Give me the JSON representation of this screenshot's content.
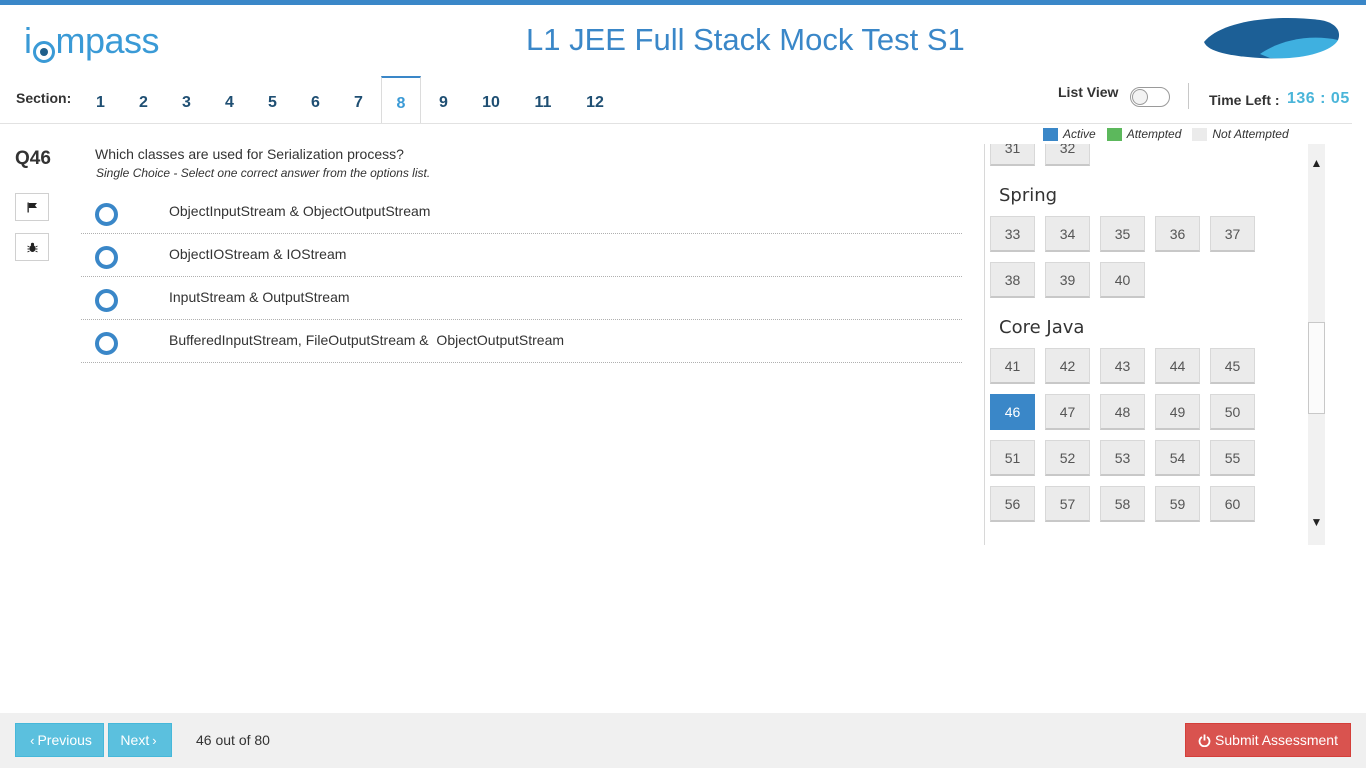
{
  "header": {
    "logo_text": "icompass",
    "title": "L1 JEE Full Stack Mock Test S1"
  },
  "sections": {
    "label": "Section:",
    "tabs": [
      "1",
      "2",
      "3",
      "4",
      "5",
      "6",
      "7",
      "8",
      "9",
      "10",
      "11",
      "12"
    ],
    "active": "8"
  },
  "controls": {
    "list_view_label": "List View",
    "list_view_on": false,
    "time_label": "Time Left :",
    "time_value": "136 : 05"
  },
  "legend": {
    "active": "Active",
    "attempted": "Attempted",
    "not_attempted": "Not Attempted",
    "colors": {
      "active": "#3a87c8",
      "attempted": "#5cb85c",
      "not_attempted": "#ebebeb"
    }
  },
  "question": {
    "number": "Q46",
    "text": "Which classes are used for Serialization process?",
    "hint": "Single Choice - Select one correct answer from the options list.",
    "options": [
      "ObjectInputStream & ObjectOutputStream",
      "ObjectIOStream & IOStream",
      "InputStream & OutputStream",
      "BufferedInputStream, FileOutputStream &  ObjectOutputStream"
    ],
    "flag_icon": "flag-icon",
    "bug_icon": "bug-icon"
  },
  "palette": {
    "partial_top": [
      "31",
      "32"
    ],
    "categories": [
      {
        "name": "Spring",
        "questions": [
          "33",
          "34",
          "35",
          "36",
          "37",
          "38",
          "39",
          "40"
        ]
      },
      {
        "name": "Core Java",
        "questions": [
          "41",
          "42",
          "43",
          "44",
          "45",
          "46",
          "47",
          "48",
          "49",
          "50",
          "51",
          "52",
          "53",
          "54",
          "55",
          "56",
          "57",
          "58",
          "59",
          "60"
        ]
      }
    ],
    "active_question": "46"
  },
  "footer": {
    "previous_label": "Previous",
    "next_label": "Next",
    "progress": "46 out of 80",
    "submit_label": "Submit Assessment"
  }
}
